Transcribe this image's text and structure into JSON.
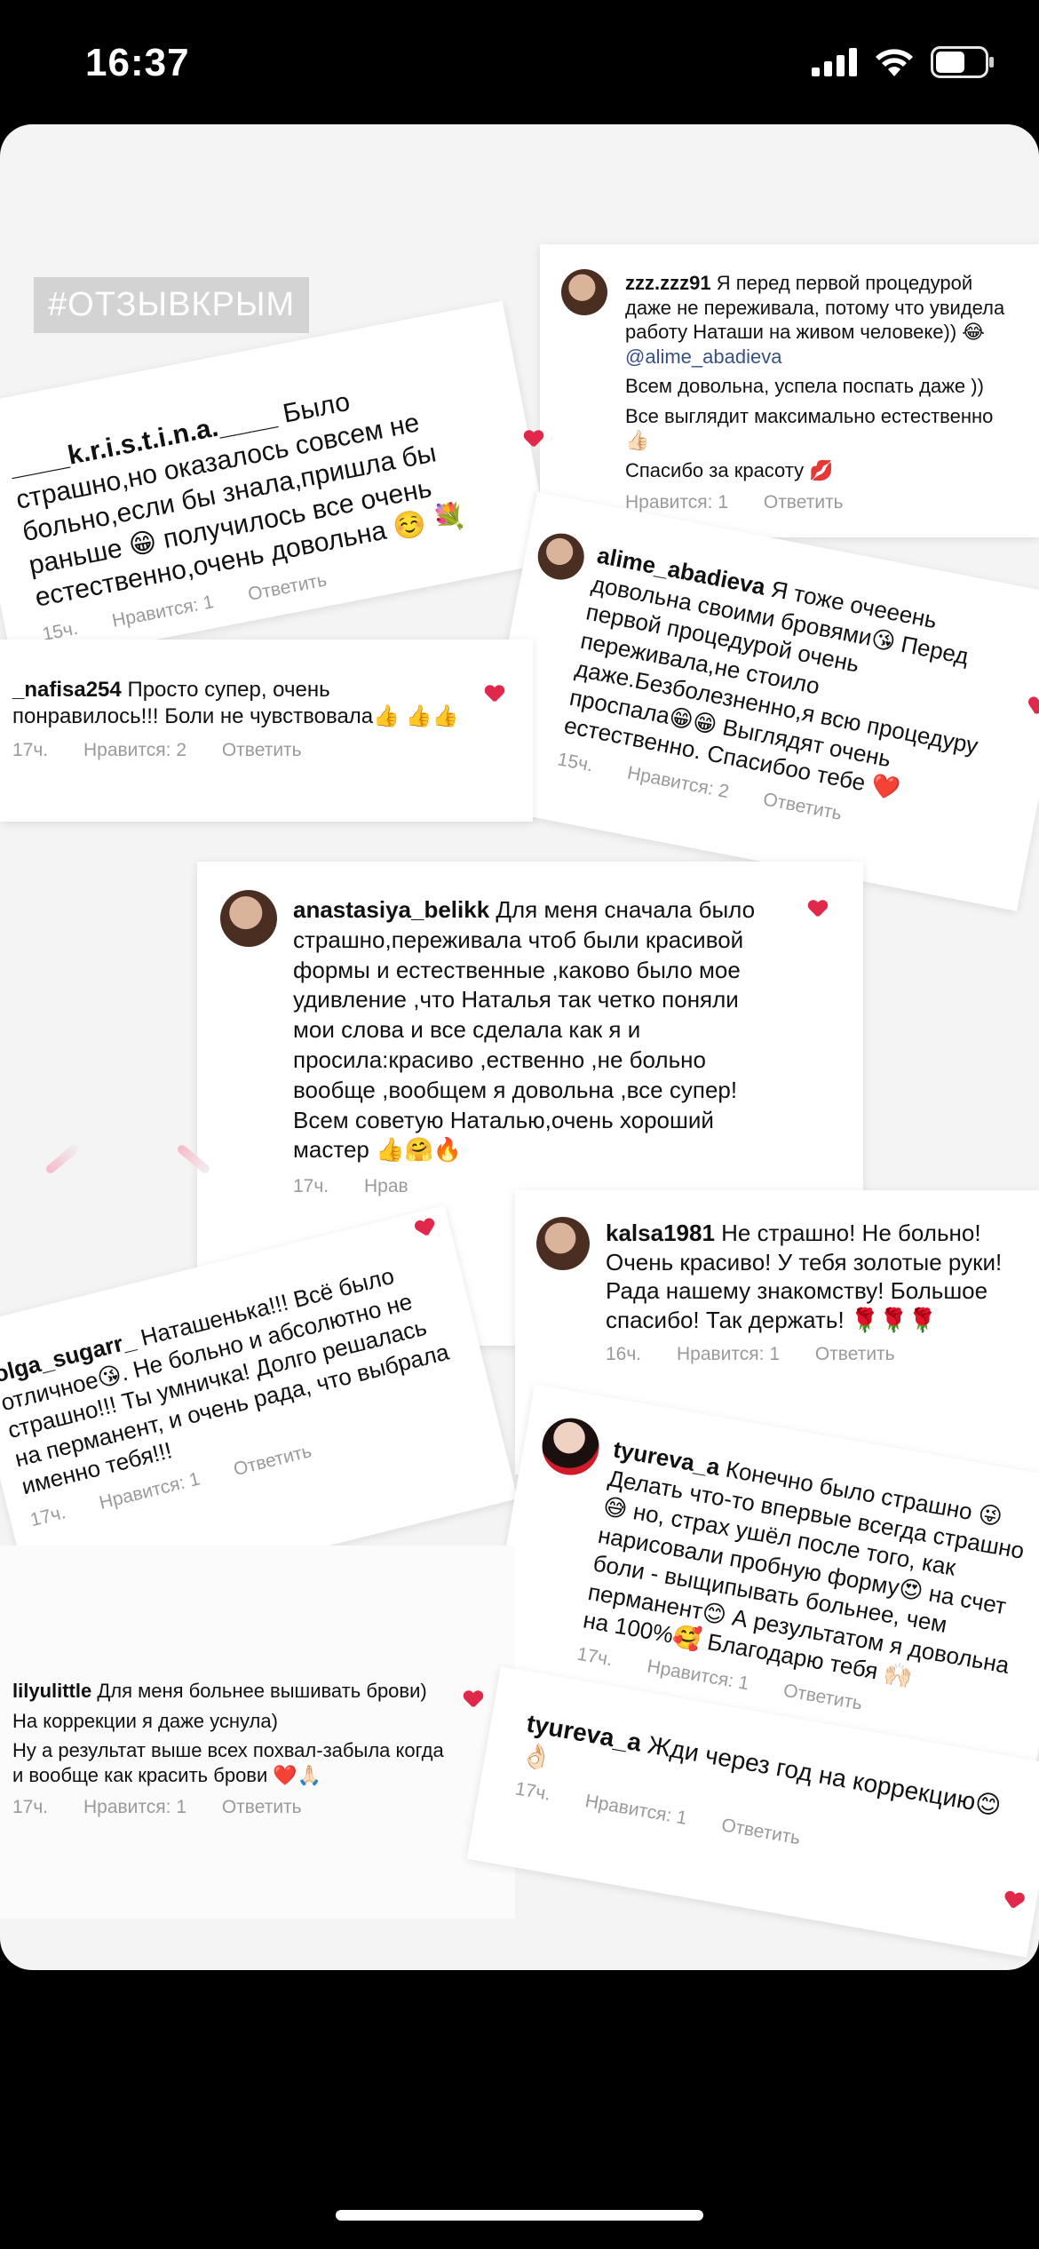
{
  "status_bar": {
    "time": "16:37",
    "battery_level": 0.6
  },
  "hashtag": "#ОТЗЫВКРЫМ",
  "meta": {
    "likes": "Нравится:",
    "reply": "Ответить"
  },
  "comments": {
    "kristina": {
      "user": "____k.r.i.s.t.i.n.a.____",
      "text": "Было страшно,но оказалось совсем не больно,если бы знала,пришла бы раньше 😁 получилось все очень естественно,очень довольна ☺️ 💐",
      "time": "15ч.",
      "likes": "Нравится: 1",
      "reply": "Ответить"
    },
    "zzz": {
      "user": "zzz.zzz91",
      "line1": "Я перед первой процедурой даже не переживала, потому что увидела работу Наташи на живом человеке)) 😂",
      "mention": "@alime_abadieva",
      "line2": "Всем довольна, успела поспать даже ))",
      "line3": "Все выглядит максимально естественно 👍🏻",
      "line4": "Спасибо за красоту 💋",
      "likes": "Нравится: 1",
      "reply": "Ответить"
    },
    "alime": {
      "user": "alime_abadieva",
      "text": "Я тоже очееень довольна своими бровями😘 Перед первой процедурой очень переживала,не стоило даже.Безболезненно,я всю процедуру проспала😁😁 Выглядят очень естественно. Спасибоо тебе ❤️",
      "time": "15ч.",
      "likes": "Нравится: 2",
      "reply": "Ответить"
    },
    "nafisa": {
      "user": "_nafisa254",
      "text": "Просто супер, очень понравилось!!! Боли не чувствовала👍 👍👍",
      "time": "17ч.",
      "likes": "Нравится: 2",
      "reply": "Ответить"
    },
    "anastasiya": {
      "user": "anastasiya_belikk",
      "text": "Для меня сначала было страшно,переживала чтоб были красивой формы и естественные ,каково было мое удивление ,что Наталья так четко поняли мои слова и все сделала как я и просила:красиво ,ественно ,не больно вообще ,вообщем я довольна ,все супер!",
      "text2": "Всем советую Наталью,очень хороший мастер 👍🤗🔥",
      "time": "17ч.",
      "likes": "Нрав"
    },
    "kalsa": {
      "user": "kalsa1981",
      "text": "Не страшно! Не больно! Очень красиво! У тебя золотые руки! Рада нашему знакомству! Большое спасибо! Так держать! 🌹🌹🌹",
      "time": "16ч.",
      "likes": "Нравится: 1",
      "reply": "Ответить"
    },
    "olga": {
      "user": "olga_sugarr_",
      "text": "Наташенька!!! Всё было отличное😘. Не больно и абсолютно не страшно!!! Ты умничка! Долго решалась на перманент, и очень рада, что выбрала именно тебя!!!",
      "time": "17ч.",
      "likes": "Нравится: 1",
      "reply": "Ответить"
    },
    "tyureva": {
      "user": "tyureva_a",
      "text": "Конечно было страшно 😜 Делать что-то впервые всегда страшно😅 но, страх ушёл после того, как нарисовали пробную форму😍 на счет боли - выщипывать больнее, чем перманент😊 А результатом я довольна на 100%🥰 Благодарю тебя 🙌🏻",
      "time": "17ч.",
      "likes": "Нравится: 1",
      "reply": "Ответить"
    },
    "lilyu": {
      "user": "lilyulittle",
      "text": "Для меня больнее вышивать брови)",
      "text2": "На коррекции я даже уснула)",
      "text3": "Ну а результат выше всех похвал-забыла когда и вообще как красить брови ❤️🙏🏻",
      "time": "17ч.",
      "likes": "Нравится: 1",
      "reply": "Ответить"
    },
    "tyureva2": {
      "user": "tyureva_a",
      "text": "Жди через год на коррекцию😊 👌🏻",
      "time": "17ч.",
      "likes": "Нравится: 1",
      "reply": "Ответить"
    }
  }
}
